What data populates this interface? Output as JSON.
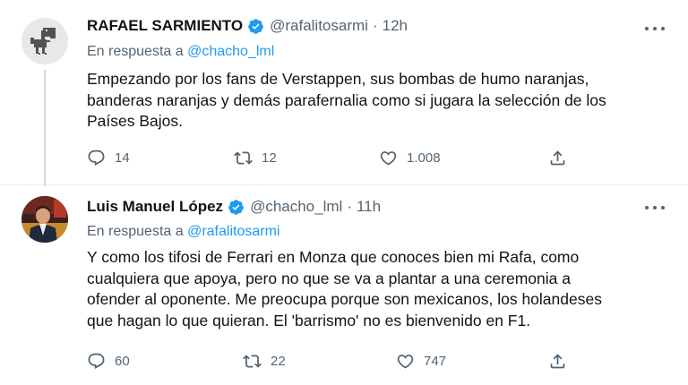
{
  "tweets": [
    {
      "name": "RAFAEL SARMIENTO",
      "handle": "@rafalitosarmi",
      "dot": "·",
      "time": "12h",
      "reply_prefix": "En respuesta a",
      "reply_to": "@chacho_lml",
      "text_lines": [
        "Empezando por los fans de Verstappen, sus bombas de humo naranjas,",
        "banderas naranjas y demás parafernalia como si jugara la selección de los",
        "Países Bajos."
      ],
      "replies": "14",
      "retweets": "12",
      "likes": "1.008",
      "avatar_icon": "dinosaur-icon"
    },
    {
      "name": "Luis Manuel López",
      "handle": "@chacho_lml",
      "dot": "·",
      "time": "11h",
      "reply_prefix": "En respuesta a",
      "reply_to": "@rafalitosarmi",
      "text_lines": [
        "Y como los tifosi de Ferrari en Monza que conoces bien mi Rafa, como",
        "cualquiera que apoya, pero no que se va a plantar a una ceremonia a",
        "ofender al oponente. Me preocupa porque son mexicanos, los holandeses",
        "que hagan lo que quieran. El 'barrismo' no es bienvenido en F1."
      ],
      "replies": "60",
      "retweets": "22",
      "likes": "747",
      "avatar_icon": "person-photo"
    }
  ],
  "colors": {
    "text": "#0f1419",
    "muted": "#536471",
    "link": "#1d9bf0",
    "verified": "#1d9bf0",
    "divider": "#e6ecf0",
    "thread_line": "#cfd9de"
  }
}
